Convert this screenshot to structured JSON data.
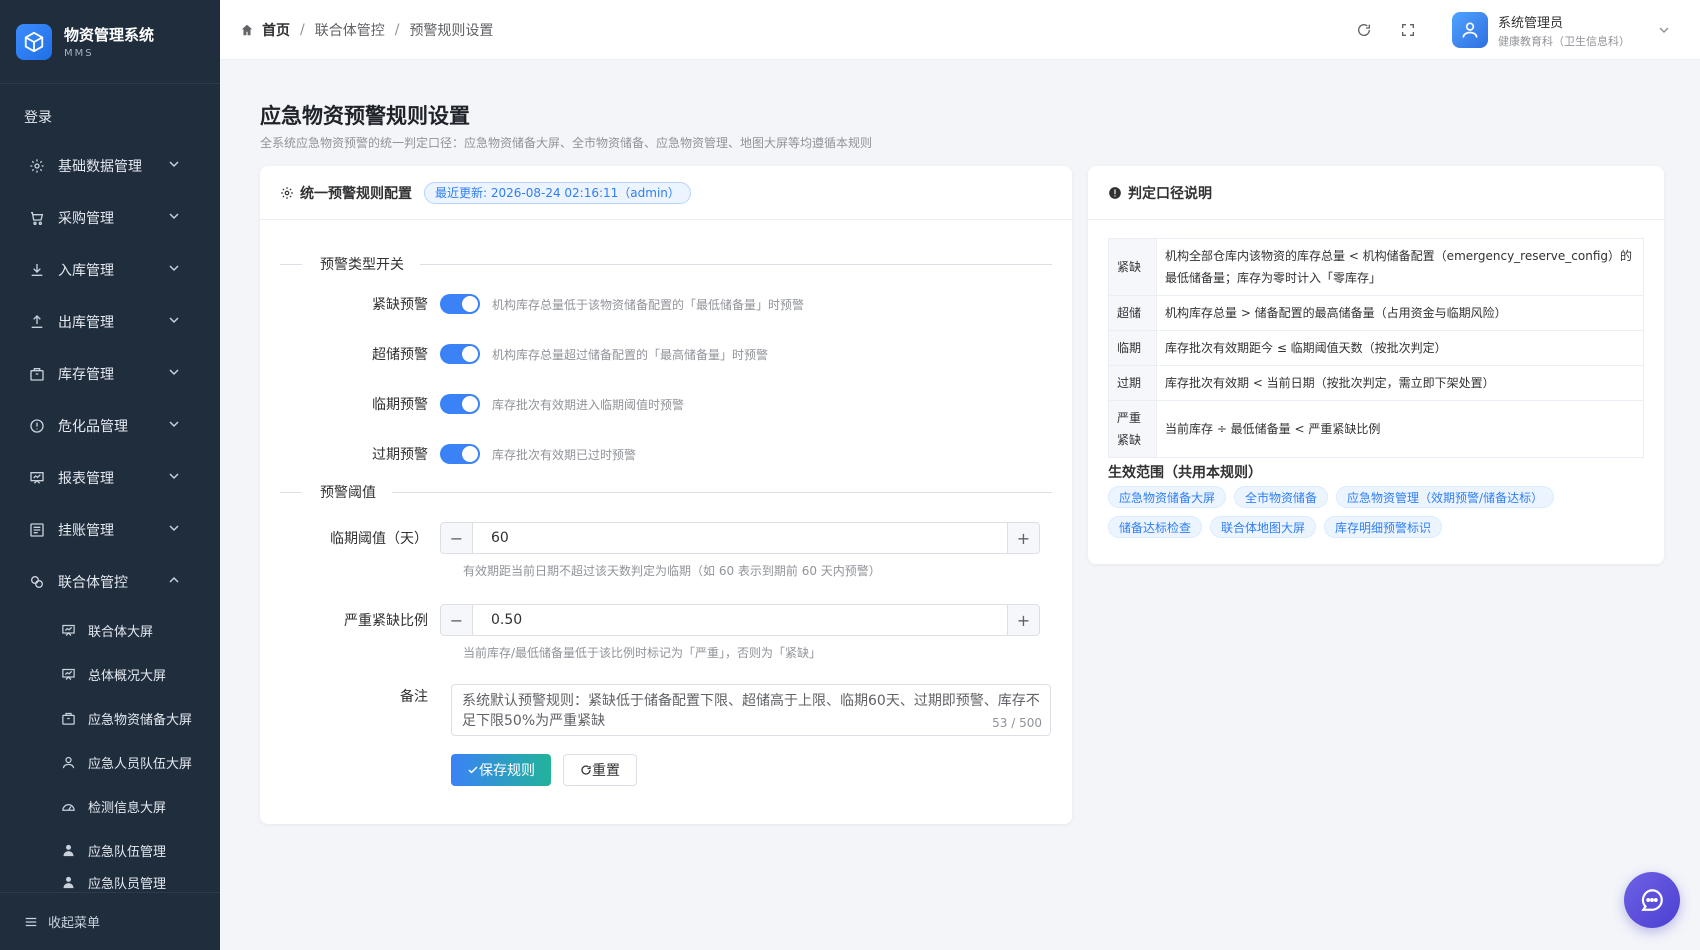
{
  "brand": {
    "title": "物资管理系统",
    "subtitle": "MMS"
  },
  "sidebar": {
    "top_label": "登录",
    "items": [
      {
        "label": "基础数据管理",
        "icon": "gear-icon"
      },
      {
        "label": "采购管理",
        "icon": "cart-icon"
      },
      {
        "label": "入库管理",
        "icon": "download-icon"
      },
      {
        "label": "出库管理",
        "icon": "upload-icon"
      },
      {
        "label": "库存管理",
        "icon": "box-icon"
      },
      {
        "label": "危化品管理",
        "icon": "warning-icon"
      },
      {
        "label": "报表管理",
        "icon": "report-icon"
      },
      {
        "label": "挂账管理",
        "icon": "ledger-icon"
      },
      {
        "label": "联合体管控",
        "icon": "link-icon"
      }
    ],
    "sub_items": [
      {
        "label": "联合体大屏",
        "icon": "screen-icon"
      },
      {
        "label": "总体概况大屏",
        "icon": "screen-icon"
      },
      {
        "label": "应急物资储备大屏",
        "icon": "box-icon"
      },
      {
        "label": "应急人员队伍大屏",
        "icon": "user-icon"
      },
      {
        "label": "检测信息大屏",
        "icon": "dashboard-icon"
      },
      {
        "label": "应急队伍管理",
        "icon": "person-icon"
      },
      {
        "label": "应急队员管理",
        "icon": "person-icon"
      }
    ],
    "collapse_label": "收起菜单"
  },
  "header": {
    "breadcrumb": [
      "首页",
      "联合体管控",
      "预警规则设置"
    ],
    "user_name": "系统管理员",
    "user_org": "健康教育科（卫生信息科）"
  },
  "page": {
    "title": "应急物资预警规则设置",
    "desc": "全系统应急物资预警的统一判定口径：应急物资储备大屏、全市物资储备、应急物资管理、地图大屏等均遵循本规则"
  },
  "config": {
    "card_title": "统一预警规则配置",
    "updated_badge": "最近更新: 2026-08-24 02:16:11（admin）",
    "section_switch": "预警类型开关",
    "switches": [
      {
        "label": "紧缺预警",
        "on": true,
        "desc": "机构库存总量低于该物资储备配置的「最低储备量」时预警"
      },
      {
        "label": "超储预警",
        "on": true,
        "desc": "机构库存总量超过储备配置的「最高储备量」时预警"
      },
      {
        "label": "临期预警",
        "on": true,
        "desc": "库存批次有效期进入临期阈值时预警"
      },
      {
        "label": "过期预警",
        "on": true,
        "desc": "库存批次有效期已过时预警"
      }
    ],
    "section_threshold": "预警阈值",
    "expiry": {
      "label": "临期阈值（天）",
      "value": "60",
      "hint": "有效期距当前日期不超过该天数判定为临期（如 60 表示到期前 60 天内预警）"
    },
    "ratio": {
      "label": "严重紧缺比例",
      "value": "0.50",
      "hint": "当前库存/最低储备量低于该比例时标记为「严重」，否则为「紧缺」"
    },
    "remark": {
      "label": "备注",
      "value": "系统默认预警规则：紧缺低于储备配置下限、超储高于上限、临期60天、过期即预警、库存不足下限50%为严重紧缺",
      "count": "53 / 500"
    },
    "save_label": "保存规则",
    "reset_label": "重置"
  },
  "explain": {
    "card_title": "判定口径说明",
    "rules": [
      {
        "key": "紧缺",
        "text": "机构全部仓库内该物资的库存总量 < 机构储备配置（emergency_reserve_config）的最低储备量；库存为零时计入「零库存」"
      },
      {
        "key": "超储",
        "text": "机构库存总量 > 储备配置的最高储备量（占用资金与临期风险）"
      },
      {
        "key": "临期",
        "text": "库存批次有效期距今 ≤ 临期阈值天数（按批次判定）"
      },
      {
        "key": "过期",
        "text": "库存批次有效期 < 当前日期（按批次判定，需立即下架处置）"
      },
      {
        "key": "严重紧缺",
        "text": "当前库存 ÷ 最低储备量 < 严重紧缺比例"
      }
    ],
    "scope_title": "生效范围（共用本规则）",
    "scope_tags": [
      "应急物资储备大屏",
      "全市物资储备",
      "应急物资管理（效期预警/储备达标）",
      "储备达标检查",
      "联合体地图大屏",
      "库存明细预警标识"
    ]
  },
  "colors": {
    "sidebar_bg": "#1f2d3d",
    "primary": "#3b82f6",
    "accent_green": "#22b39a"
  }
}
